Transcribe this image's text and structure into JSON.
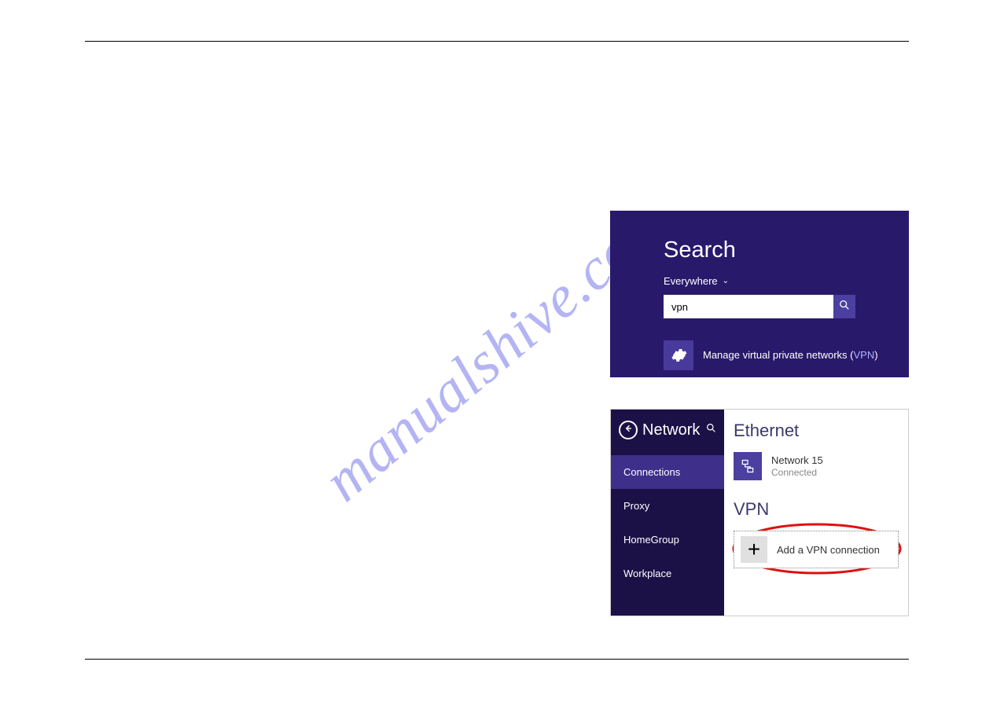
{
  "watermark": "manualshive.com",
  "search": {
    "title": "Search",
    "scope": "Everywhere",
    "input_value": "vpn",
    "result": {
      "prefix": "Manage virtual private networks (",
      "highlight": "VPN",
      "suffix": ")"
    }
  },
  "network": {
    "title": "Network",
    "nav": {
      "connections": "Connections",
      "proxy": "Proxy",
      "homegroup": "HomeGroup",
      "workplace": "Workplace"
    },
    "ethernet": {
      "heading": "Ethernet",
      "name": "Network 15",
      "status": "Connected"
    },
    "vpn": {
      "heading": "VPN",
      "add_label": "Add a VPN connection"
    }
  }
}
